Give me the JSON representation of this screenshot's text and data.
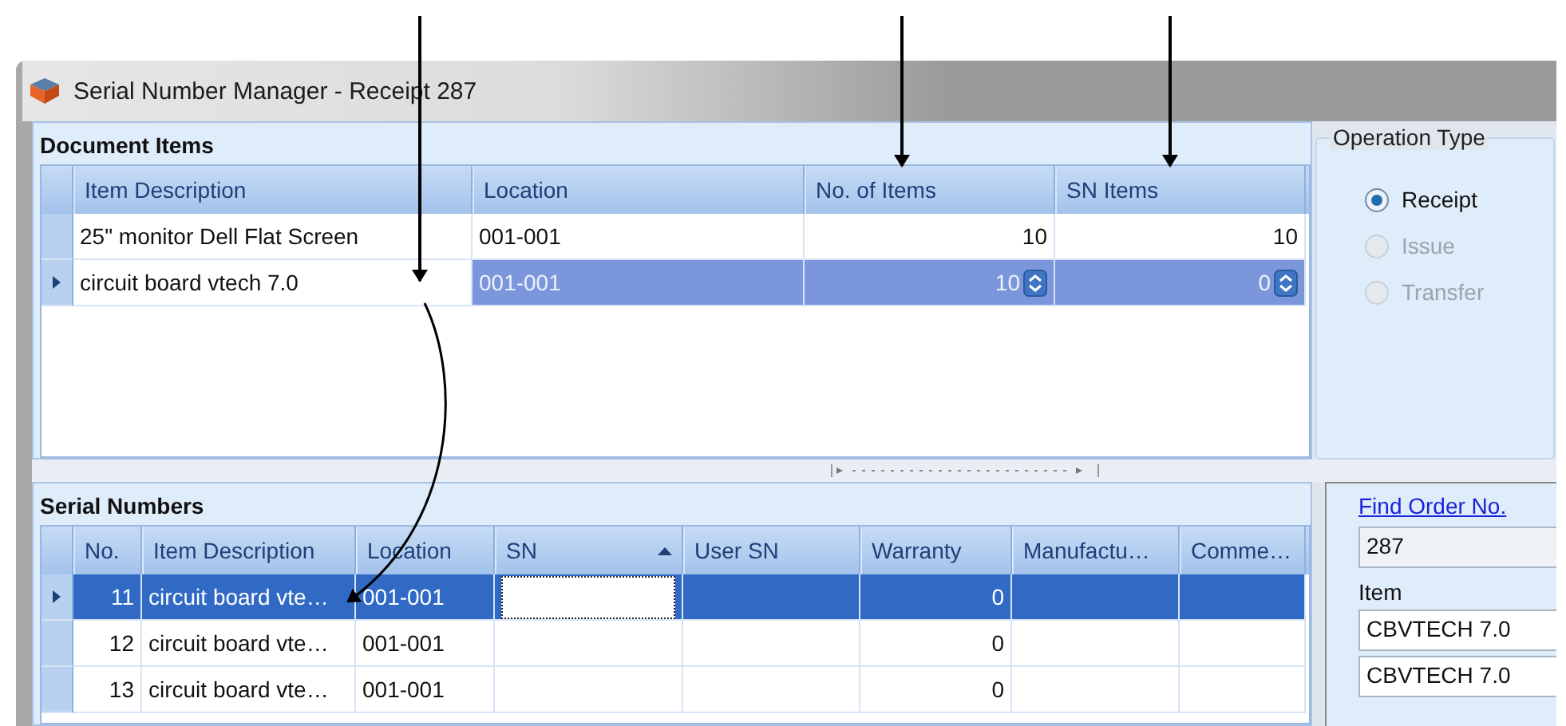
{
  "window": {
    "title": "Serial Number Manager - Receipt 287"
  },
  "document_items": {
    "title": "Document Items",
    "columns": [
      {
        "label": "Item Description",
        "kind": "text"
      },
      {
        "label": "Location",
        "kind": "text"
      },
      {
        "label": "No. of Items",
        "kind": "number"
      },
      {
        "label": "SN Items",
        "kind": "number"
      }
    ],
    "rows": [
      {
        "cells": [
          "25\" monitor Dell Flat Screen",
          "001-001",
          "10",
          "10"
        ],
        "selected": false
      },
      {
        "cells": [
          "circuit board vtech 7.0",
          "001-001",
          "10",
          "0"
        ],
        "selected": true
      }
    ]
  },
  "operation_type": {
    "title": "Operation Type",
    "options": [
      {
        "label": "Receipt",
        "selected": true,
        "disabled": false
      },
      {
        "label": "Issue",
        "selected": false,
        "disabled": true
      },
      {
        "label": "Transfer",
        "selected": false,
        "disabled": true
      }
    ]
  },
  "serial_numbers": {
    "title": "Serial Numbers",
    "columns": [
      {
        "label": "No.",
        "kind": "number"
      },
      {
        "label": "Item Description",
        "kind": "text"
      },
      {
        "label": "Location",
        "kind": "text"
      },
      {
        "label": "SN",
        "kind": "serial",
        "sorted_ascending": true
      },
      {
        "label": "User SN",
        "kind": "text"
      },
      {
        "label": "Warranty",
        "kind": "number"
      },
      {
        "label": "Manufactu…",
        "kind": "text"
      },
      {
        "label": "Comme…",
        "kind": "text"
      }
    ],
    "rows": [
      {
        "cells": [
          "11",
          "circuit board vte…",
          "001-001",
          null,
          null,
          "0",
          null,
          null
        ],
        "selected": true,
        "editing": true
      },
      {
        "cells": [
          "12",
          "circuit board vte…",
          "001-001",
          null,
          null,
          "0",
          null,
          null
        ],
        "selected": false,
        "editing": false
      },
      {
        "cells": [
          "13",
          "circuit board vte…",
          "001-001",
          null,
          null,
          "0",
          null,
          null
        ],
        "selected": false,
        "editing": false
      }
    ]
  },
  "order": {
    "link": "Find Order No.",
    "order_no": "287",
    "item_label": "Item",
    "items": [
      "CBVTECH 7.0",
      "CBVTECH 7.0"
    ]
  }
}
